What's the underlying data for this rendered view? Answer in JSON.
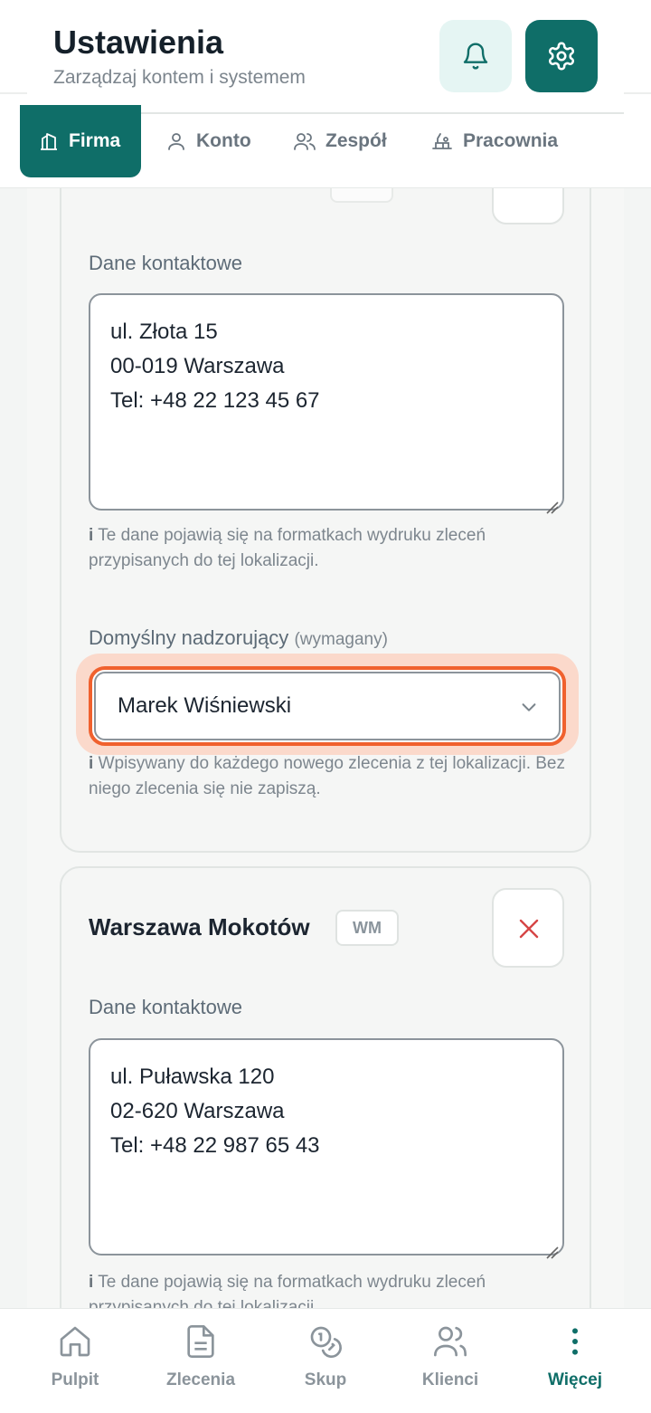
{
  "header": {
    "title": "Ustawienia",
    "subtitle": "Zarządzaj kontem i systemem"
  },
  "tabs": [
    {
      "label": "Firma",
      "icon": "building-icon",
      "active": true
    },
    {
      "label": "Konto",
      "icon": "user-icon",
      "active": false
    },
    {
      "label": "Zespół",
      "icon": "users-icon",
      "active": false
    },
    {
      "label": "Pracownia",
      "icon": "workbench-icon",
      "active": false
    }
  ],
  "locations": [
    {
      "contact_label": "Dane kontaktowe",
      "contact_lines": [
        "ul. Złota 15",
        "00-019 Warszawa",
        "Tel: +48 22 123 45 67"
      ],
      "contact_hint_prefix": "i",
      "contact_hint": "Te dane pojawią się na formatkach wydruku zleceń przypisanych do tej lokalizacji.",
      "supervisor_label": "Domyślny nadzorujący",
      "supervisor_required": "(wymagany)",
      "supervisor_value": "Marek Wiśniewski",
      "supervisor_hint_prefix": "i",
      "supervisor_hint": "Wpisywany do każdego nowego zlecenia z tej lokalizacji. Bez niego zlecenia się nie zapiszą."
    },
    {
      "name": "Warszawa Mokotów",
      "code": "WM",
      "contact_label": "Dane kontaktowe",
      "contact_lines": [
        "ul. Puławska 120",
        "02-620 Warszawa",
        "Tel: +48 22 987 65 43"
      ],
      "contact_hint_prefix": "i",
      "contact_hint": "Te dane pojawią się na formatkach wydruku zleceń przypisanych do tej lokalizacji."
    }
  ],
  "bottom_nav": [
    {
      "label": "Pulpit",
      "icon": "home-icon",
      "active": false
    },
    {
      "label": "Zlecenia",
      "icon": "document-icon",
      "active": false
    },
    {
      "label": "Skup",
      "icon": "coins-icon",
      "active": false
    },
    {
      "label": "Klienci",
      "icon": "users-icon",
      "active": false
    },
    {
      "label": "Więcej",
      "icon": "more-vertical-icon",
      "active": true
    }
  ],
  "colors": {
    "brand": "#0f6e68",
    "focus_outline": "#f0612e",
    "delete": "#d64545"
  }
}
